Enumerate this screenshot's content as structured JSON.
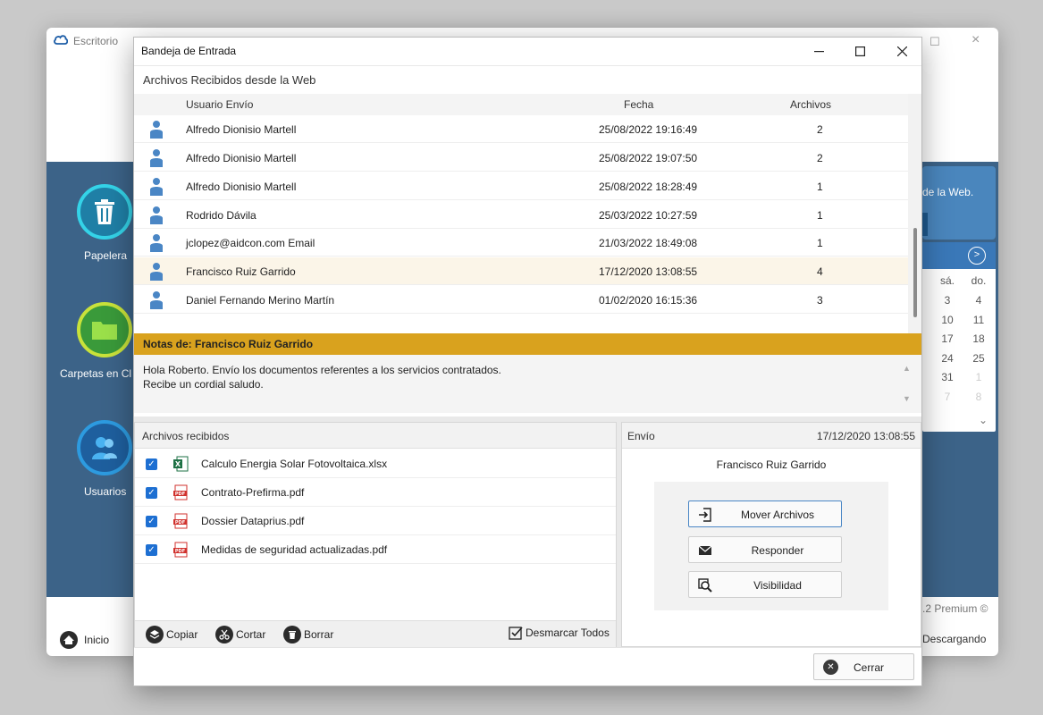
{
  "background_app": {
    "title": "Escritorio",
    "side_icons": [
      {
        "label": "Papelera",
        "icon": "trash-icon"
      },
      {
        "label": "Carpetas en Cl",
        "icon": "folder-icon"
      },
      {
        "label": "Usuarios",
        "icon": "users-icon"
      }
    ],
    "web_panel_text": "de la Web.",
    "calendar": {
      "headers": [
        "sá.",
        "do."
      ],
      "rows": [
        [
          "3",
          "4"
        ],
        [
          "10",
          "11"
        ],
        [
          "17",
          "18"
        ],
        [
          "24",
          "25"
        ],
        [
          "31",
          "1"
        ],
        [
          "7",
          "8"
        ]
      ]
    },
    "premium_text": ".2 Premium ©",
    "status_text": "Descargando",
    "inicio_label": "Inicio"
  },
  "dialog": {
    "title": "Bandeja de Entrada",
    "section_title": "Archivos Recibidos desde la Web",
    "table": {
      "headers": {
        "user": "Usuario Envío",
        "date": "Fecha",
        "files": "Archivos"
      },
      "rows": [
        {
          "user": "Alfredo Dionisio Martell",
          "date": "25/08/2022 19:16:49",
          "files": "2"
        },
        {
          "user": "Alfredo Dionisio Martell",
          "date": "25/08/2022 19:07:50",
          "files": "2"
        },
        {
          "user": "Alfredo Dionisio Martell",
          "date": "25/08/2022 18:28:49",
          "files": "1"
        },
        {
          "user": "Rodrido Dávila",
          "date": "25/03/2022 10:27:59",
          "files": "1"
        },
        {
          "user": "jclopez@aidcon.com Email",
          "date": "21/03/2022 18:49:08",
          "files": "1"
        },
        {
          "user": "Francisco Ruiz Garrido",
          "date": "17/12/2020 13:08:55",
          "files": "4"
        },
        {
          "user": "Daniel Fernando Merino Martín",
          "date": "01/02/2020 16:15:36",
          "files": "3"
        }
      ],
      "selected_index": 5
    },
    "notes": {
      "title": "Notas de: Francisco Ruiz Garrido",
      "line1": "Hola Roberto. Envío los documentos referentes a los servicios contratados.",
      "line2": "Recibe un cordial saludo."
    },
    "files": {
      "title": "Archivos recibidos",
      "items": [
        {
          "name": "Calculo Energia Solar Fotovoltaica.xlsx",
          "type": "xlsx",
          "checked": true
        },
        {
          "name": "Contrato-Prefirma.pdf",
          "type": "pdf",
          "checked": true
        },
        {
          "name": "Dossier Dataprius.pdf",
          "type": "pdf",
          "checked": true
        },
        {
          "name": "Medidas de seguridad actualizadas.pdf",
          "type": "pdf",
          "checked": true
        }
      ],
      "toolbar": {
        "copy": "Copiar",
        "cut": "Cortar",
        "delete": "Borrar",
        "uncheck_all": "Desmarcar Todos"
      }
    },
    "envio": {
      "title": "Envío",
      "datetime": "17/12/2020 13:08:55",
      "user": "Francisco Ruiz Garrido",
      "actions": {
        "move": "Mover Archivos",
        "reply": "Responder",
        "visibility": "Visibilidad"
      }
    },
    "close_label": "Cerrar"
  },
  "colors": {
    "notes_bar": "#d9a21e",
    "app_blue": "#3c6388",
    "selected_row": "#fbf5e8",
    "checkbox": "#1d6fd2",
    "user_icon": "#4a86c5"
  }
}
